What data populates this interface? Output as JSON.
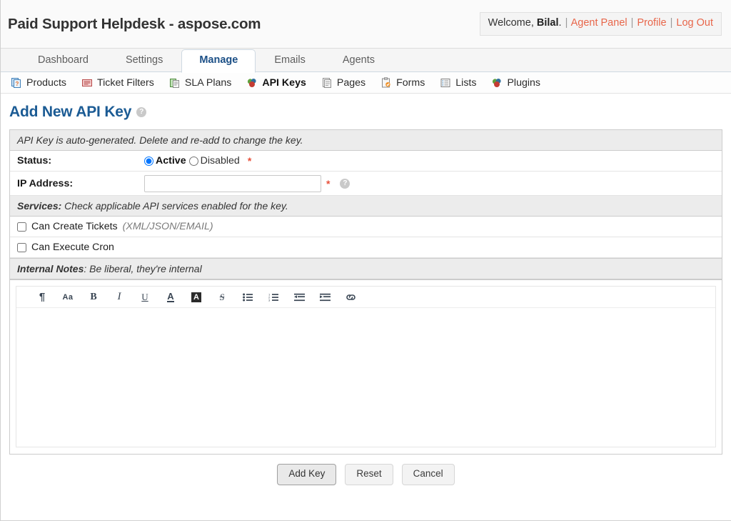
{
  "header": {
    "site_title": "Paid Support Helpdesk - aspose.com",
    "welcome_prefix": "Welcome,",
    "user_name": "Bilal",
    "user_suffix": ".",
    "links": [
      {
        "label": "Agent Panel"
      },
      {
        "label": "Profile"
      },
      {
        "label": "Log Out"
      }
    ],
    "separator": "|"
  },
  "tabs": [
    {
      "label": "Dashboard",
      "active": false
    },
    {
      "label": "Settings",
      "active": false
    },
    {
      "label": "Manage",
      "active": true
    },
    {
      "label": "Emails",
      "active": false
    },
    {
      "label": "Agents",
      "active": false
    }
  ],
  "subnav": [
    {
      "label": "Products",
      "icon": "product-doc-icon",
      "active": false
    },
    {
      "label": "Ticket Filters",
      "icon": "ticket-filter-icon",
      "active": false
    },
    {
      "label": "SLA Plans",
      "icon": "sla-plan-icon",
      "active": false
    },
    {
      "label": "API Keys",
      "icon": "api-keys-icon",
      "active": true
    },
    {
      "label": "Pages",
      "icon": "pages-icon",
      "active": false
    },
    {
      "label": "Forms",
      "icon": "forms-clipboard-icon",
      "active": false
    },
    {
      "label": "Lists",
      "icon": "lists-icon",
      "active": false
    },
    {
      "label": "Plugins",
      "icon": "plugins-icon",
      "active": false
    }
  ],
  "page": {
    "title": "Add New API Key",
    "help_glyph": "?",
    "info_bar": "API Key is auto-generated. Delete and re-add to change the key.",
    "required_marker": "*"
  },
  "form": {
    "status": {
      "label": "Status:",
      "options": [
        {
          "label": "Active",
          "selected": true
        },
        {
          "label": "Disabled",
          "selected": false
        }
      ]
    },
    "ip_address": {
      "label": "IP Address:",
      "value": "",
      "placeholder": ""
    },
    "services_bar": {
      "title": "Services:",
      "text": "Check applicable API services enabled for the key."
    },
    "services": [
      {
        "label": "Can Create Tickets",
        "hint": "(XML/JSON/EMAIL)",
        "checked": false
      },
      {
        "label": "Can Execute Cron",
        "hint": "",
        "checked": false
      }
    ],
    "notes_bar": {
      "title": "Internal Notes",
      "text": ": Be liberal, they're internal"
    },
    "notes_value": ""
  },
  "editor_toolbar": [
    {
      "name": "paragraph-icon",
      "glyph": "¶"
    },
    {
      "name": "font-size-icon",
      "glyph": "Aa"
    },
    {
      "name": "bold-icon",
      "glyph": "B"
    },
    {
      "name": "italic-icon",
      "glyph": "I"
    },
    {
      "name": "underline-icon",
      "glyph": "U"
    },
    {
      "name": "text-color-icon",
      "glyph": "A"
    },
    {
      "name": "highlight-color-icon",
      "glyph": "A"
    },
    {
      "name": "strikethrough-icon",
      "glyph": "S"
    },
    {
      "name": "bullet-list-icon",
      "glyph": ""
    },
    {
      "name": "numbered-list-icon",
      "glyph": ""
    },
    {
      "name": "outdent-icon",
      "glyph": ""
    },
    {
      "name": "indent-icon",
      "glyph": ""
    },
    {
      "name": "link-icon",
      "glyph": ""
    }
  ],
  "buttons": {
    "submit": "Add Key",
    "reset": "Reset",
    "cancel": "Cancel"
  },
  "colors": {
    "accent_link": "#e8664a",
    "title_blue": "#1b5b94",
    "tab_active_text": "#1b4f86",
    "required_red": "#e8503a",
    "bar_bg": "#ececec",
    "border": "#cccccc"
  }
}
